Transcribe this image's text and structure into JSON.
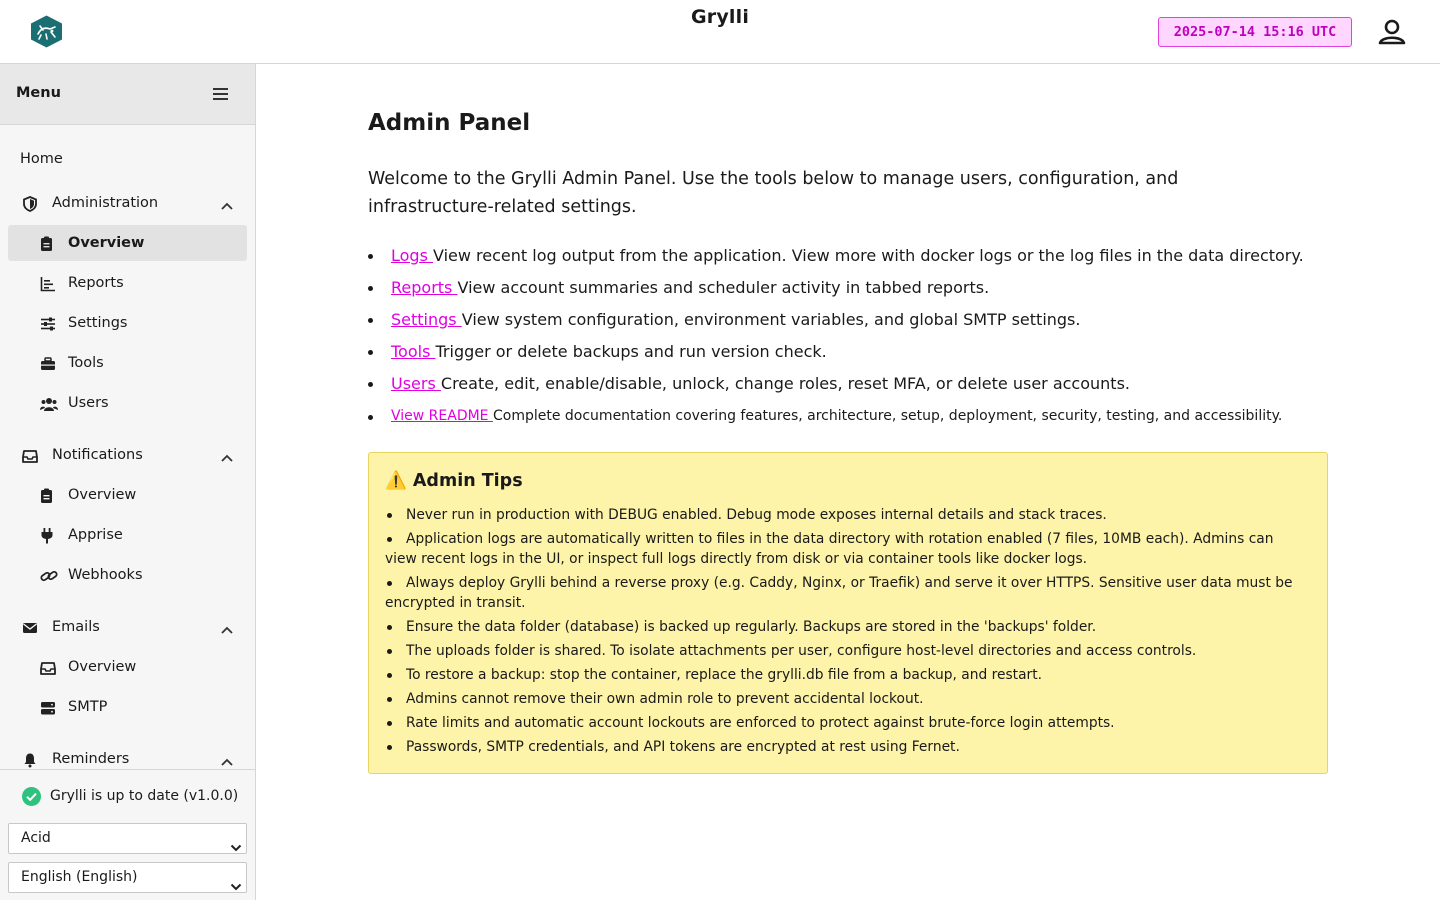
{
  "header": {
    "app_title": "Grylli",
    "clock": "2025-07-14 15:16 UTC",
    "logo_icon": "grylli-logo-icon",
    "user_icon": "user-icon"
  },
  "sidebar": {
    "menu_title": "Menu",
    "home": "Home",
    "administration": {
      "label": "Administration",
      "items": [
        "Overview",
        "Reports",
        "Settings",
        "Tools",
        "Users"
      ],
      "active": "Overview"
    },
    "notifications": {
      "label": "Notifications",
      "items": [
        "Overview",
        "Apprise",
        "Webhooks"
      ]
    },
    "emails": {
      "label": "Emails",
      "items": [
        "Overview",
        "SMTP"
      ]
    },
    "reminders": {
      "label": "Reminders"
    },
    "status": "Grylli is up to date (v1.0.0)",
    "theme_select": "Acid",
    "language_select": "English (English)"
  },
  "main": {
    "title": "Admin Panel",
    "intro": "Welcome to the Grylli Admin Panel. Use the tools below to manage users, configuration, and infrastructure-related settings.",
    "links": [
      {
        "link": "Logs ",
        "desc": "View recent log output from the application. View more with docker logs or the log files in the data directory."
      },
      {
        "link": "Reports ",
        "desc": "View account summaries and scheduler activity in tabbed reports."
      },
      {
        "link": "Settings ",
        "desc": "View system configuration, environment variables, and global SMTP settings."
      },
      {
        "link": "Tools ",
        "desc": "Trigger or delete backups and run version check."
      },
      {
        "link": "Users ",
        "desc": "Create, edit, enable/disable, unlock, change roles, reset MFA, or delete user accounts."
      },
      {
        "link": "View README ",
        "desc": "Complete documentation covering features, architecture, setup, deployment, security, testing, and accessibility."
      }
    ],
    "tips": {
      "icon": "⚠️",
      "title": "Admin Tips",
      "items": [
        "Never run in production with DEBUG enabled. Debug mode exposes internal details and stack traces.",
        "Application logs are automatically written to files in the data directory with rotation enabled (7 files, 10MB each). Admins can view recent logs in the UI, or inspect full logs directly from disk or via container tools like docker logs.",
        "Always deploy Grylli behind a reverse proxy (e.g. Caddy, Nginx, or Traefik) and serve it over HTTPS. Sensitive user data must be encrypted in transit.",
        "Ensure the data folder (database) is backed up regularly. Backups are stored in the 'backups' folder.",
        "The uploads folder is shared. To isolate attachments per user, configure host-level directories and access controls.",
        "To restore a backup: stop the container, replace the grylli.db file from a backup, and restart.",
        "Admins cannot remove their own admin role to prevent accidental lockout.",
        "Rate limits and automatic account lockouts are enforced to protect against brute-force login attempts.",
        "Passwords, SMTP credentials, and API tokens are encrypted at rest using Fernet."
      ]
    }
  },
  "colors": {
    "link": "#e100e1",
    "clock_bg": "#ffd6ff",
    "tips_bg": "#fdf3a9",
    "logo": "#1b6f72",
    "status_ok": "#2ec27e"
  }
}
